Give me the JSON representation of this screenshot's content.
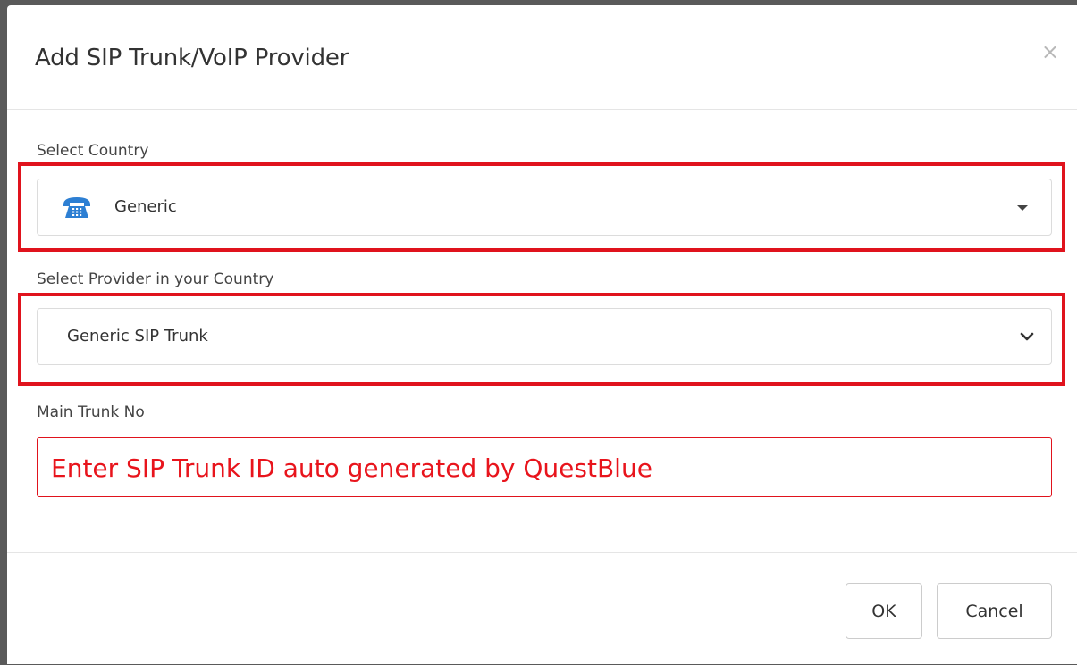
{
  "dialog": {
    "title": "Add SIP Trunk/VoIP Provider",
    "close_symbol": "×"
  },
  "country": {
    "label": "Select Country",
    "icon": "telephone-icon",
    "value": "Generic"
  },
  "provider": {
    "label": "Select Provider in your Country",
    "value": "Generic SIP Trunk"
  },
  "trunk": {
    "label": "Main Trunk No",
    "placeholder": "Enter SIP Trunk ID auto generated by QuestBlue"
  },
  "footer": {
    "ok_label": "OK",
    "cancel_label": "Cancel"
  },
  "colors": {
    "highlight": "#e0131d",
    "icon_blue": "#2d7fd3"
  }
}
